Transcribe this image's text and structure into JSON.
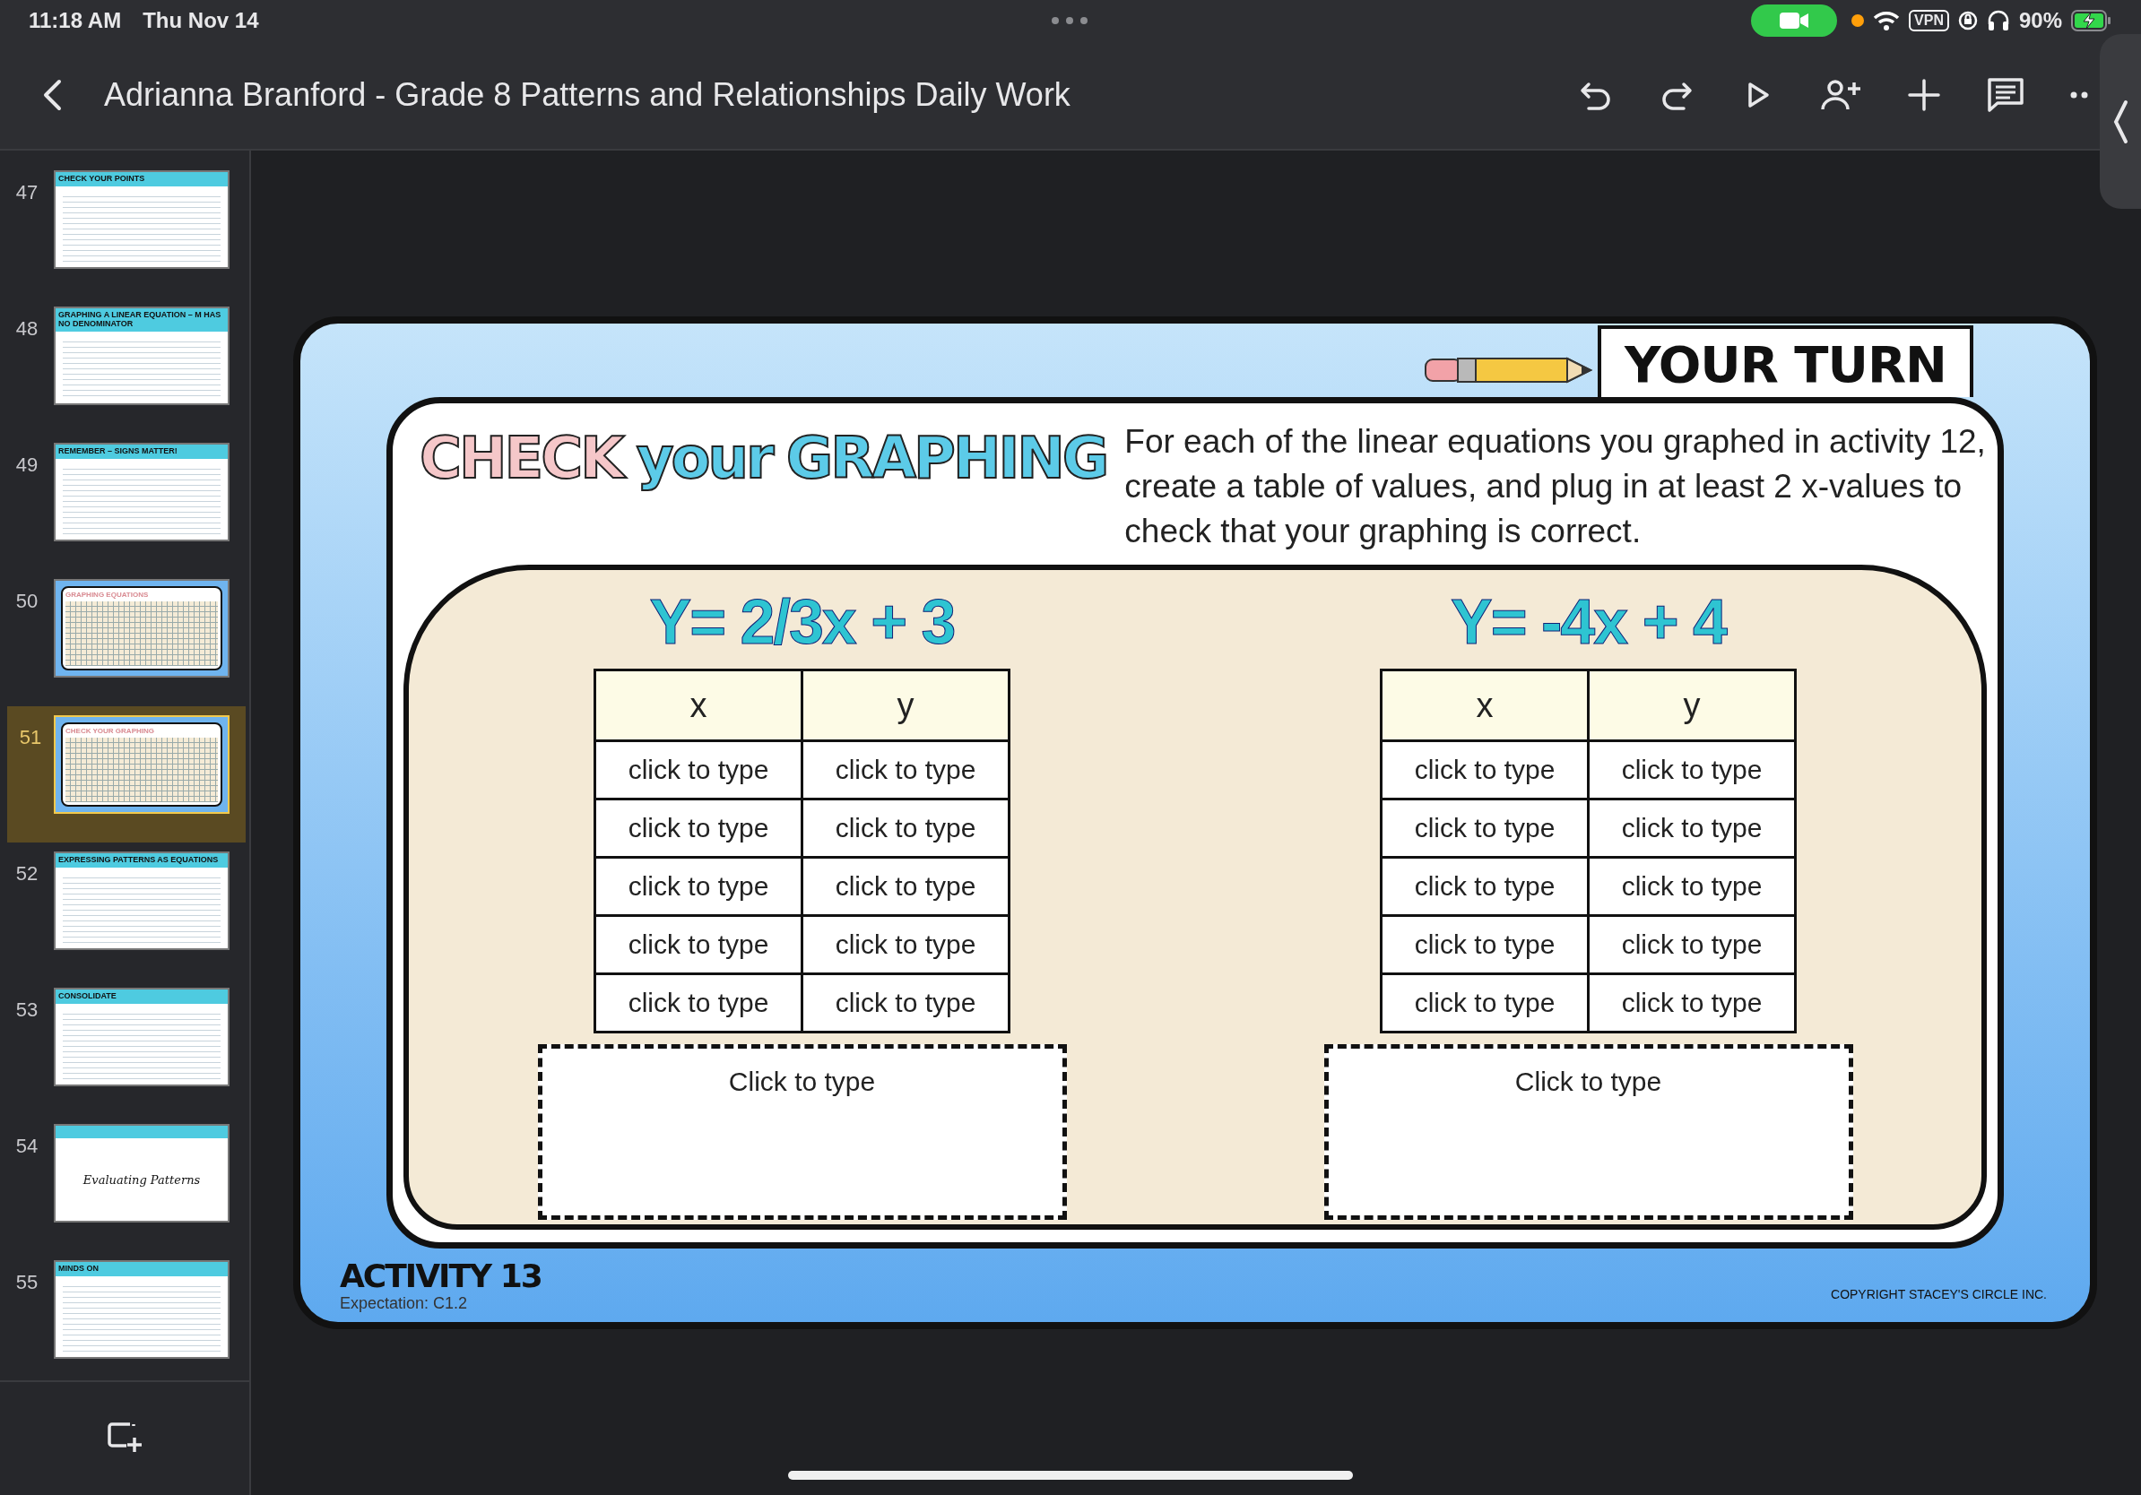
{
  "status_bar": {
    "time": "11:18 AM",
    "date": "Thu Nov 14",
    "vpn": "VPN",
    "battery": "90%"
  },
  "toolbar": {
    "title": "Adrianna Branford - Grade 8 Patterns and Relationships Daily Work"
  },
  "slides": [
    {
      "number": "47",
      "kind": "lesson",
      "title": "CHECK YOUR POINTS",
      "selected": false
    },
    {
      "number": "48",
      "kind": "lesson",
      "title": "GRAPHING A LINEAR EQUATION – M HAS NO DENOMINATOR",
      "selected": false
    },
    {
      "number": "49",
      "kind": "lesson",
      "title": "REMEMBER – SIGNS MATTER!",
      "selected": false
    },
    {
      "number": "50",
      "kind": "activity",
      "title": "GRAPHING EQUATIONS",
      "selected": false
    },
    {
      "number": "51",
      "kind": "activity",
      "title": "CHECK YOUR GRAPHING",
      "selected": true
    },
    {
      "number": "52",
      "kind": "lesson",
      "title": "EXPRESSING PATTERNS AS EQUATIONS",
      "selected": false
    },
    {
      "number": "53",
      "kind": "lesson",
      "title": "CONSOLIDATE",
      "selected": false
    },
    {
      "number": "54",
      "kind": "cover",
      "title": "Evaluating Patterns",
      "selected": false
    },
    {
      "number": "55",
      "kind": "lesson",
      "title": "MINDS ON",
      "selected": false
    }
  ],
  "slide": {
    "banner": "YOUR TURN",
    "title": [
      "CHECK",
      "your",
      "GRAPHING"
    ],
    "instructions": "For each of the linear equations you graphed in activity 12, create a table of values, and plug in at least 2 x-values to check that your graphing is correct.",
    "equations": [
      {
        "equation": "Y= 2/3x + 3",
        "columns": [
          "x",
          "y"
        ],
        "rows": [
          [
            "click to type",
            "click to type"
          ],
          [
            "click to type",
            "click to type"
          ],
          [
            "click to type",
            "click to type"
          ],
          [
            "click to type",
            "click to type"
          ],
          [
            "click to type",
            "click to type"
          ]
        ],
        "answer_box": "Click to type"
      },
      {
        "equation": "Y= -4x + 4",
        "columns": [
          "x",
          "y"
        ],
        "rows": [
          [
            "click to type",
            "click to type"
          ],
          [
            "click to type",
            "click to type"
          ],
          [
            "click to type",
            "click to type"
          ],
          [
            "click to type",
            "click to type"
          ],
          [
            "click to type",
            "click to type"
          ]
        ],
        "answer_box": "Click to type"
      }
    ],
    "activity": "ACTIVITY 13",
    "expectation": "Expectation:  C1.2",
    "copyright": "COPYRIGHT STACEY'S CIRCLE INC."
  }
}
